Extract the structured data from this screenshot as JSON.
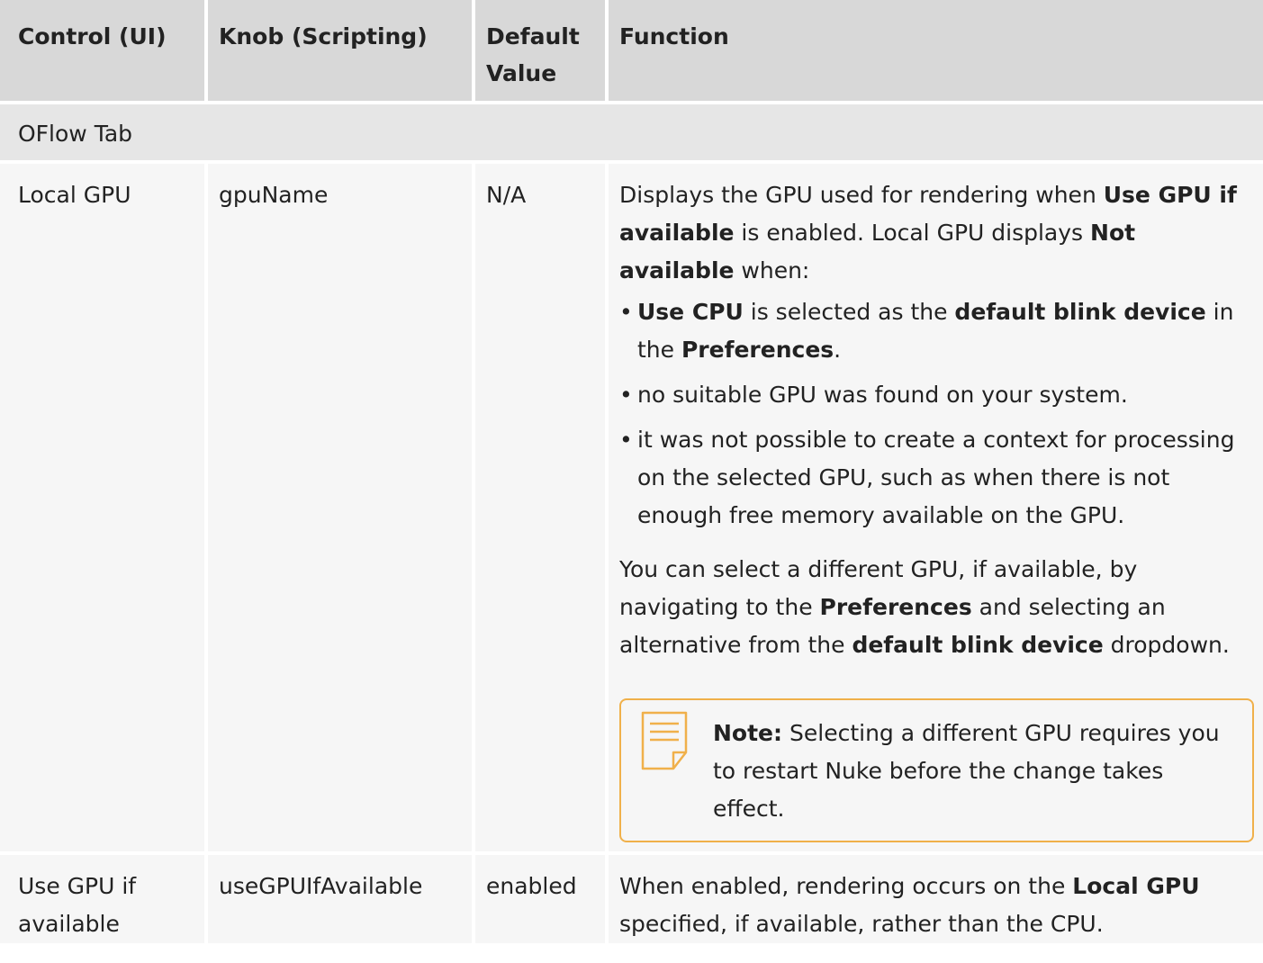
{
  "headers": {
    "control": "Control (UI)",
    "knob": "Knob (Scripting)",
    "default": "Default Value",
    "function": "Function"
  },
  "section": {
    "title": "OFlow Tab"
  },
  "rows": [
    {
      "control": "Local GPU",
      "knob": "gpuName",
      "default": "N/A",
      "function": {
        "p1_a": "Displays the GPU used for rendering when ",
        "p1_b": "Use GPU if available",
        "p1_c": " is enabled. Local GPU displays ",
        "p1_d": "Not available",
        "p1_e": " when:",
        "bullet_char": "•",
        "bullet1_a": "Use CPU",
        "bullet1_b": " is selected as the ",
        "bullet1_c": "default blink device",
        "bullet1_d": " in the ",
        "bullet1_e": "Preferences",
        "bullet1_f": ".",
        "bullet2": "no suitable GPU was found on your system.",
        "bullet3": "it was not possible to create a context for processing on the selected GPU, such as when there is not enough free memory available on the GPU.",
        "p2_a": "You can select a different GPU, if available, by navigating to the ",
        "p2_b": "Preferences",
        "p2_c": " and selecting an alternative from the ",
        "p2_d": "default blink device",
        "p2_e": " dropdown.",
        "note_label": "Note:",
        "note_text": "Selecting a different GPU requires you to restart Nuke before the change takes effect.",
        "note_icon": "note-document-icon",
        "note_color": "#f0b04a"
      }
    },
    {
      "control": "Use GPU if available",
      "knob": "useGPUIfAvailable",
      "default": "enabled",
      "function": {
        "a": "When enabled, rendering occurs on the ",
        "b": "Local GPU",
        "c": " specified, if available, rather than the CPU."
      }
    }
  ],
  "colors": {
    "header_bg": "#d8d8d8",
    "section_bg": "#e6e6e6",
    "row_bg": "#f6f6f6",
    "accent": "#f0b04a"
  }
}
